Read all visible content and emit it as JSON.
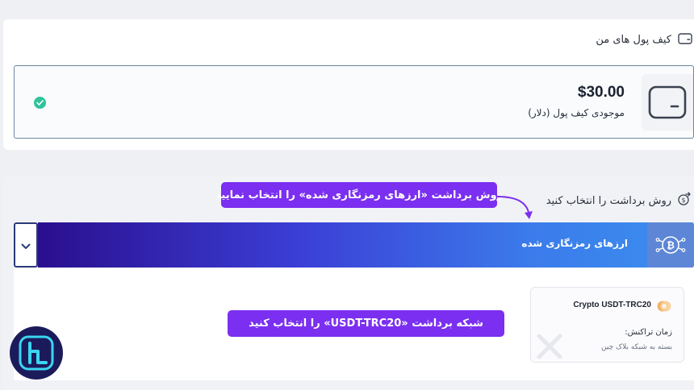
{
  "wallet": {
    "title": "کیف پول های من",
    "balance_amount": "$30.00",
    "balance_label": "موجودی کیف پول (دلار)"
  },
  "withdraw": {
    "title": "روش برداشت را انتخاب کنید",
    "method_label": "ارزهای رمزنگاری شده"
  },
  "crypto_option": {
    "name": "Crypto USDT-TRC20",
    "time_label": "زمان تراکنش:",
    "time_value": "بسته به شبکه بلاک چین"
  },
  "annotations": {
    "step1": "روش برداشت «ارزهای رمزنگاری شده» را انتخاب نمایید",
    "step2": "شبکه برداشت «USDT-TRC20» را انتخاب کنید"
  },
  "colors": {
    "accent_purple": "#7b2ff0",
    "success_green": "#2ec39b",
    "selected_gradient_start": "#2a0f8e",
    "selected_gradient_end": "#3b8ff0"
  },
  "icons": {
    "wallet_header": "wallet-icon",
    "balance": "wallet-icon",
    "status": "check-circle-icon",
    "withdraw_header": "money-transfer-icon",
    "method": "bitcoin-network-icon",
    "dropdown": "chevron-down-icon",
    "crypto_logo": "crypto-coin-icon"
  }
}
